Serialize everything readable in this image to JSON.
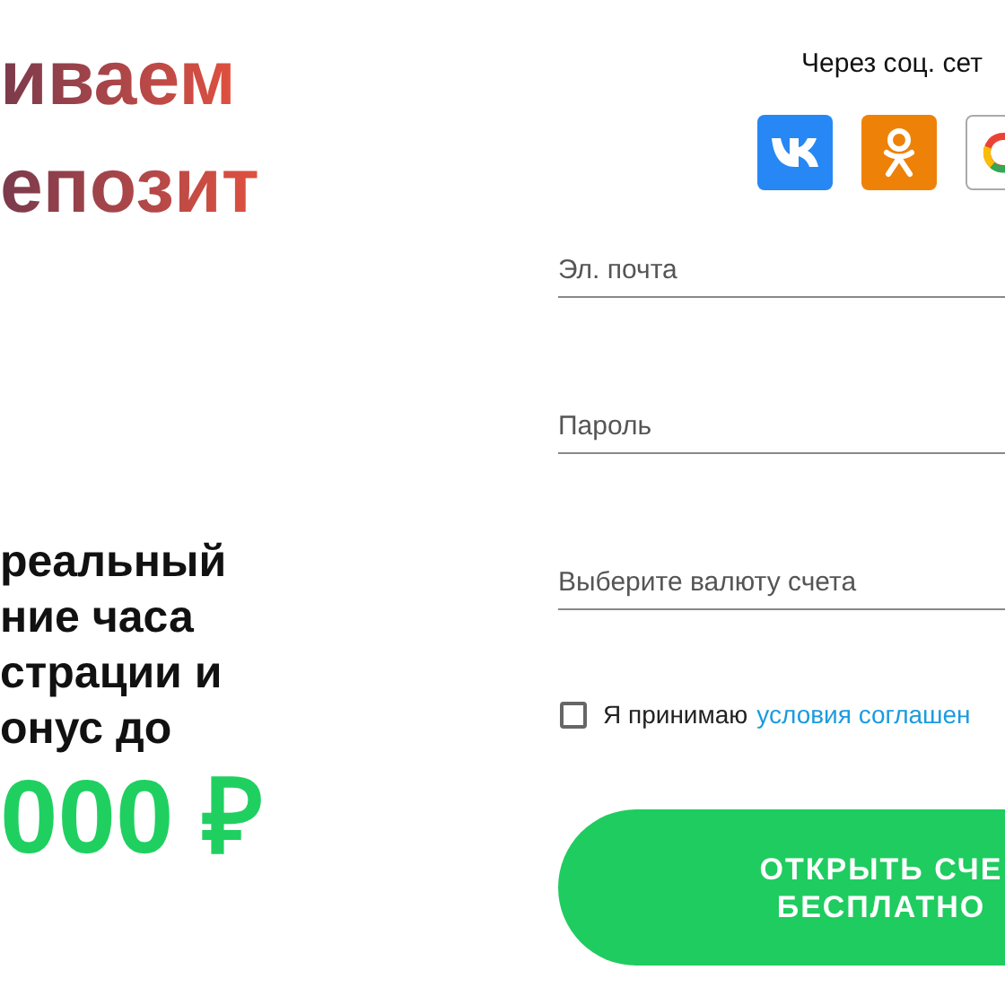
{
  "headline": [
    "иваем",
    "епозит"
  ],
  "offer": {
    "lines": [
      "реальный",
      "ние часа",
      "страции и",
      "онус до"
    ],
    "amount": "000 ₽"
  },
  "social": {
    "title": "Через соц. сет",
    "buttons": [
      {
        "kind": "vk"
      },
      {
        "kind": "ok"
      },
      {
        "kind": "google"
      }
    ]
  },
  "fields": [
    {
      "placeholder": "Эл. почта"
    },
    {
      "placeholder": "Пароль"
    },
    {
      "placeholder": "Выберите валюту счета"
    }
  ],
  "agreement": {
    "checked": false,
    "text": "Я принимаю",
    "link": "условия соглашен"
  },
  "submit": [
    "ОТКРЫТЬ СЧЕ",
    "БЕСПЛАТНО"
  ]
}
